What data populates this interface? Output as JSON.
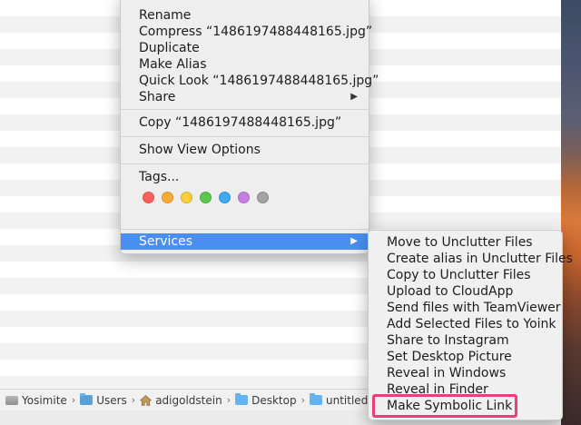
{
  "path_bar": {
    "segments": [
      "Yosimite",
      "Users",
      "adigoldstein",
      "Desktop",
      "untitled folder"
    ],
    "separator": "›"
  },
  "context_menu": {
    "items_group1": [
      "Rename",
      "Compress “1486197488448165.jpg”",
      "Duplicate",
      "Make Alias",
      "Quick Look “1486197488448165.jpg”",
      "Share"
    ],
    "copy_item": "Copy “1486197488448165.jpg”",
    "show_view_options": "Show View Options",
    "tags_label": "Tags...",
    "tag_colors": [
      "#fc605c",
      "#fdaa35",
      "#f9d03c",
      "#5ac84d",
      "#3ea9f5",
      "#c57fe3",
      "#a3a3a3"
    ],
    "services_label": "Services",
    "arrow": "▶"
  },
  "services_submenu": {
    "items": [
      "Move to Unclutter Files",
      "Create alias in Unclutter Files",
      "Copy to Unclutter Files",
      "Upload to CloudApp",
      "Send files with TeamViewer",
      "Add Selected Files to Yoink",
      "Share to Instagram",
      "Set Desktop Picture",
      "Reveal in Windows",
      "Reveal in Finder",
      "Make Symbolic Link"
    ]
  },
  "colors": {
    "highlight": "#4a8ef2",
    "callout": "#ea3f7e"
  }
}
